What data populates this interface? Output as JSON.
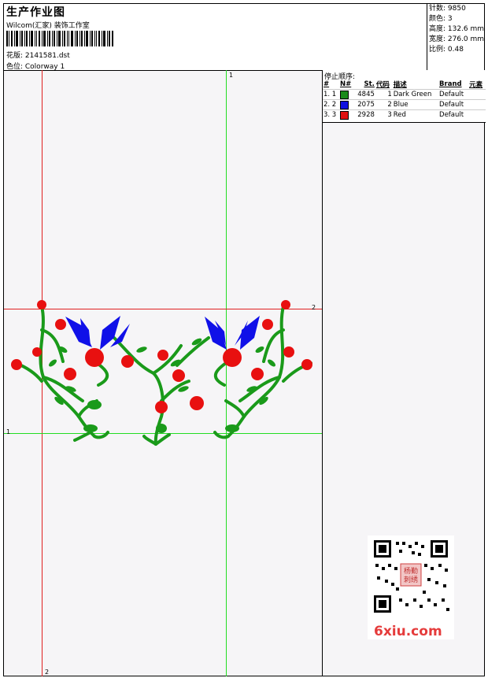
{
  "header": {
    "title": "生产作业图",
    "company": "Wilcom(汇家) 装饰工作室",
    "design": "花版: 2141581.dst",
    "colorway": "色位: Colorway 1"
  },
  "stats": {
    "stitches": "针数: 9850",
    "colors": "颜色: 3",
    "height": "高度: 132.6 mm",
    "width": "宽度: 276.0 mm",
    "scale": "比例: 0.48"
  },
  "legend": {
    "heading": "停止顺序:",
    "columns": [
      "#",
      "N#",
      "St.",
      "代码",
      "描述",
      "Brand",
      "元素"
    ],
    "rows": [
      {
        "num": "1. 1",
        "color": "#1a8a1a",
        "st": "4845",
        "code": "1",
        "desc": "Dark Green",
        "brand": "Default"
      },
      {
        "num": "2. 2",
        "color": "#1010e0",
        "st": "2075",
        "code": "2",
        "desc": "Blue",
        "brand": "Default"
      },
      {
        "num": "3. 3",
        "color": "#e01010",
        "st": "2928",
        "code": "3",
        "desc": "Red",
        "brand": "Default"
      }
    ]
  },
  "axes": {
    "green_v_top": "1",
    "red_h_right": "2",
    "green_h_left": "1",
    "red_v_bottom": "2"
  },
  "watermark": "6xiu.com",
  "qr_stamp": "杨勤刺绣"
}
